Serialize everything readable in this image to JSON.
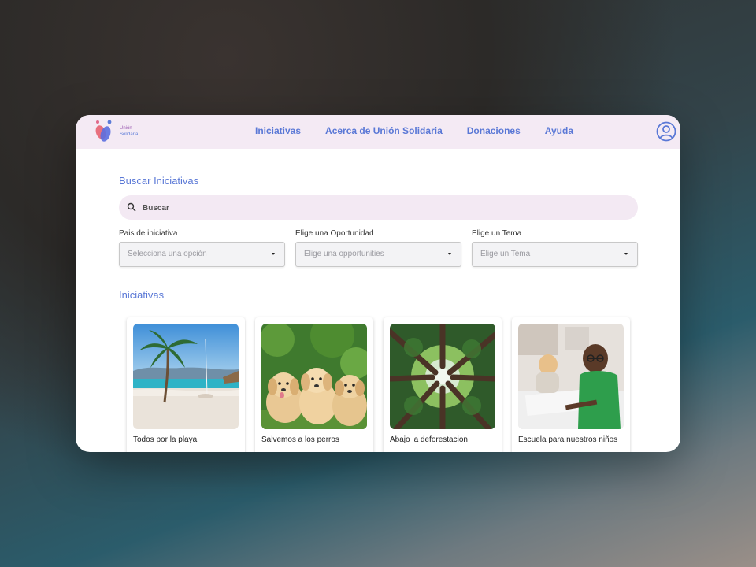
{
  "brand": {
    "line1": "Unión",
    "line2": "Solidaria"
  },
  "nav": {
    "links": [
      "Iniciativas",
      "Acerca de Unión Solidaria",
      "Donaciones",
      "Ayuda"
    ]
  },
  "search": {
    "title": "Buscar Iniciativas",
    "placeholder": "Buscar"
  },
  "filters": [
    {
      "label": "Pais de iniciativa",
      "placeholder": "Selecciona una opción"
    },
    {
      "label": "Elige una Oportunidad",
      "placeholder": "Elige una opportunities"
    },
    {
      "label": "Elige un Tema",
      "placeholder": "Elige un Tema"
    }
  ],
  "initiatives": {
    "title": "Iniciativas",
    "cards": [
      {
        "title": "Todos por la playa"
      },
      {
        "title": "Salvemos a los perros"
      },
      {
        "title": "Abajo la deforestacion"
      },
      {
        "title": "Escuela para nuestros niños"
      }
    ]
  },
  "colors": {
    "accent": "#5a78d6",
    "nav_bg": "#f4eaf4",
    "search_bg": "#f3e9f3"
  }
}
